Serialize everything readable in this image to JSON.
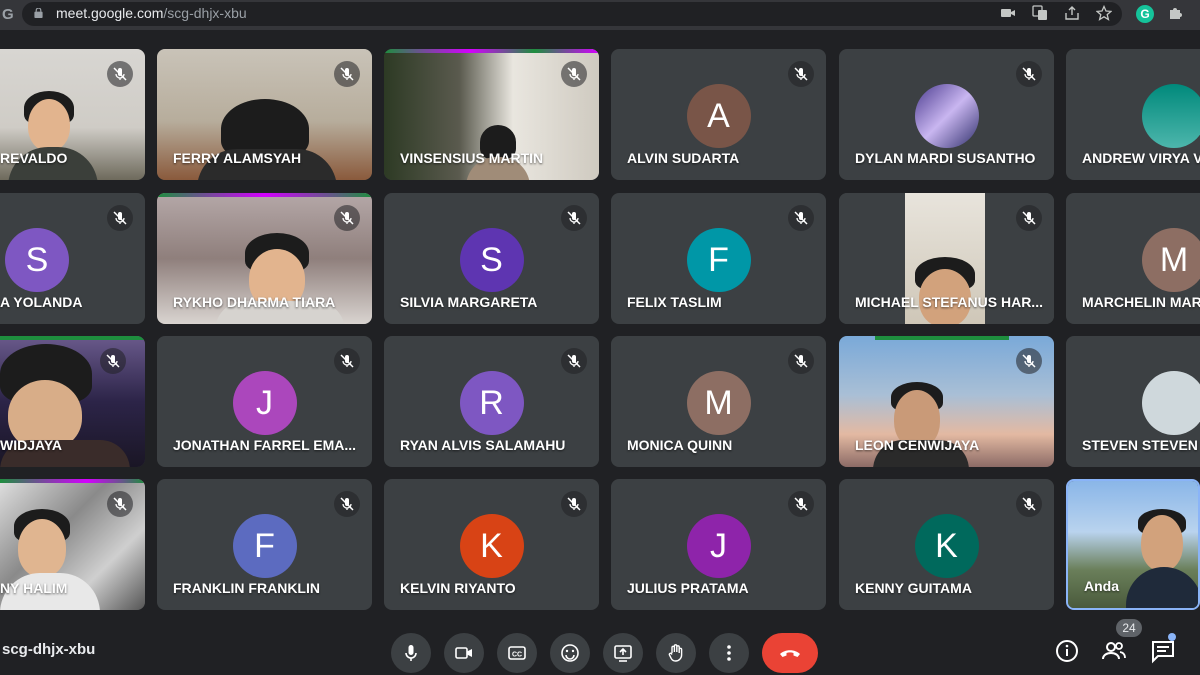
{
  "browser": {
    "url_host": "meet.google.com",
    "url_path": "/scg-dhjx-xbu",
    "icons": [
      "google-icon",
      "lock-icon",
      "camera-blocked-icon",
      "translate-icon",
      "share-icon",
      "bookmark-star-icon",
      "grammarly-icon",
      "extensions-puzzle-icon"
    ],
    "grammarly_letter": "G"
  },
  "participants": [
    {
      "name": "REVALDO",
      "type": "video"
    },
    {
      "name": "FERRY ALAMSYAH",
      "type": "video"
    },
    {
      "name": "VINSENSIUS MARTIN",
      "type": "video"
    },
    {
      "name": "ALVIN SUDARTA",
      "type": "avatar",
      "initial": "A",
      "color": "#795548"
    },
    {
      "name": "DYLAN MARDI SUSANTHO",
      "type": "avatar-image"
    },
    {
      "name": "ANDREW VIRYA VI",
      "type": "avatar-image"
    },
    {
      "name": "A YOLANDA",
      "type": "avatar",
      "initial": "S",
      "color": "#7e57c2"
    },
    {
      "name": "RYKHO DHARMA TIARA",
      "type": "video"
    },
    {
      "name": "SILVIA MARGARETA",
      "type": "avatar",
      "initial": "S",
      "color": "#5e35b1"
    },
    {
      "name": "FELIX TASLIM",
      "type": "avatar",
      "initial": "F",
      "color": "#0097a7"
    },
    {
      "name": "MICHAEL STEFANUS HAR...",
      "type": "video"
    },
    {
      "name": "MARCHELIN MAR",
      "type": "avatar",
      "initial": "M",
      "color": "#8d6e63"
    },
    {
      "name": "WIDJAYA",
      "type": "video"
    },
    {
      "name": "JONATHAN FARREL EMA...",
      "type": "avatar",
      "initial": "J",
      "color": "#ab47bc"
    },
    {
      "name": "RYAN ALVIS SALAMAHU",
      "type": "avatar",
      "initial": "R",
      "color": "#7e57c2"
    },
    {
      "name": "MONICA QUINN",
      "type": "avatar",
      "initial": "M",
      "color": "#8d6e63"
    },
    {
      "name": "LEON CENWIJAYA",
      "type": "video"
    },
    {
      "name": "STEVEN STEVEN",
      "type": "avatar-image"
    },
    {
      "name": "NY HALIM",
      "type": "video"
    },
    {
      "name": "FRANKLIN FRANKLIN",
      "type": "avatar",
      "initial": "F",
      "color": "#5c6bc0"
    },
    {
      "name": "KELVIN RIYANTO",
      "type": "avatar",
      "initial": "K",
      "color": "#d84315"
    },
    {
      "name": "JULIUS PRATAMA",
      "type": "avatar",
      "initial": "J",
      "color": "#8e24aa"
    },
    {
      "name": "KENNY GUITAMA",
      "type": "avatar",
      "initial": "K",
      "color": "#00695c"
    },
    {
      "name": "Anda",
      "type": "self-video"
    }
  ],
  "bottom": {
    "meeting_code": "scg-dhjx-xbu",
    "controls": [
      "mic-icon",
      "camera-icon",
      "captions-icon",
      "emoji-icon",
      "present-icon",
      "raise-hand-icon",
      "more-options-icon",
      "hang-up-icon"
    ],
    "participant_count": "24"
  },
  "colors": {
    "background": "#202124",
    "tile": "#3c4043",
    "hangup": "#ea4335",
    "active_speaker": "#1e8e3e",
    "self_border": "#8ab4f8"
  }
}
